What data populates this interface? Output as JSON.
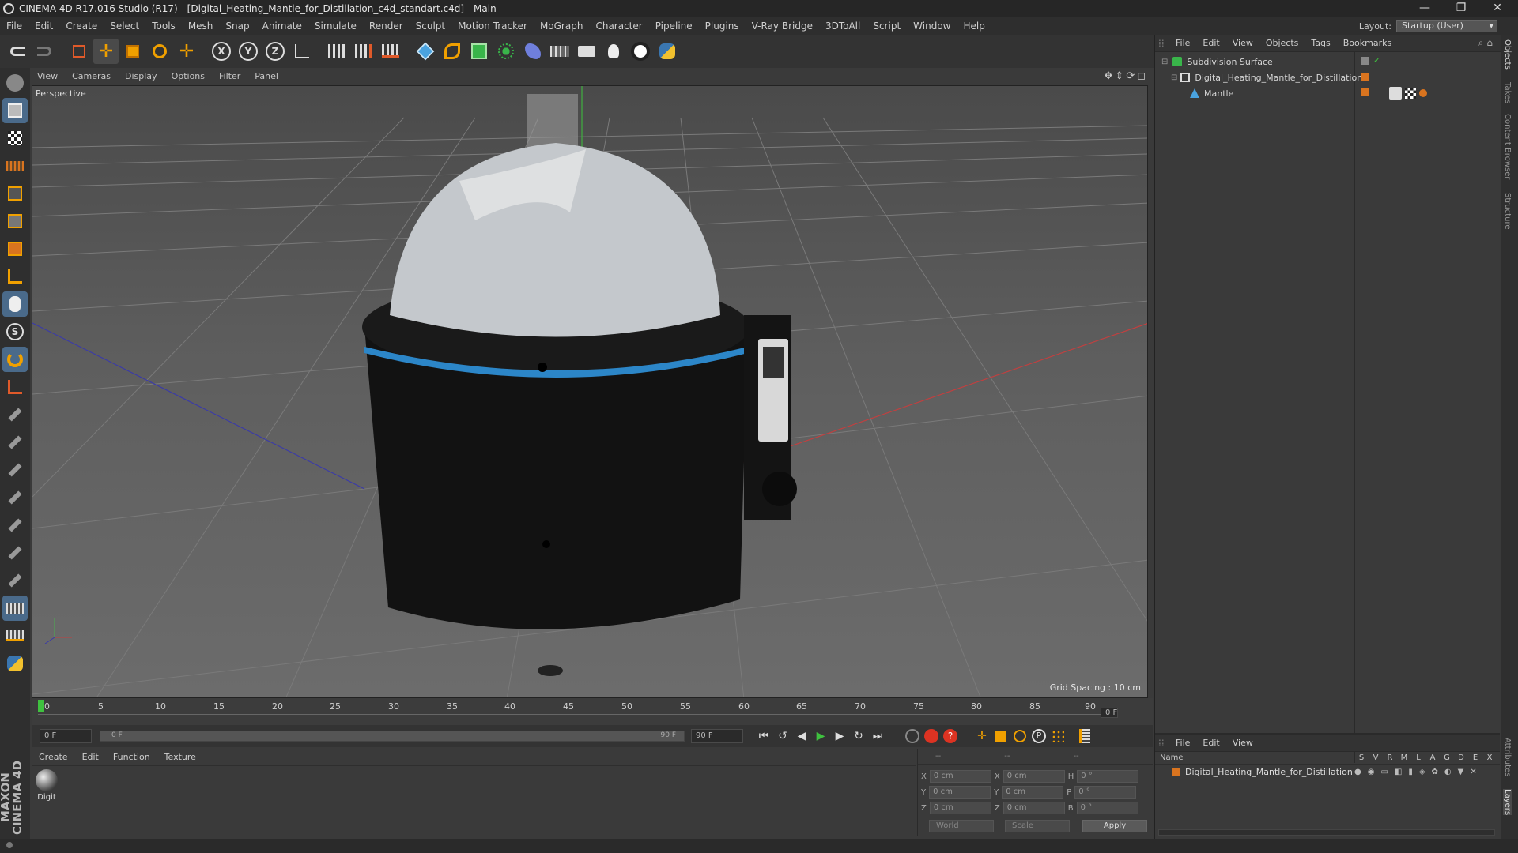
{
  "window": {
    "title": "CINEMA 4D R17.016 Studio (R17) - [Digital_Heating_Mantle_for_Distillation_c4d_standart.c4d] - Main",
    "minimize": "—",
    "restore": "❐",
    "close": "✕"
  },
  "menu": [
    "File",
    "Edit",
    "Create",
    "Select",
    "Tools",
    "Mesh",
    "Snap",
    "Animate",
    "Simulate",
    "Render",
    "Sculpt",
    "Motion Tracker",
    "MoGraph",
    "Character",
    "Pipeline",
    "Plugins",
    "V-Ray Bridge",
    "3DToAll",
    "Script",
    "Window",
    "Help"
  ],
  "layout": {
    "label": "Layout:",
    "value": "Startup (User)"
  },
  "viewport": {
    "menu": [
      "View",
      "Cameras",
      "Display",
      "Options",
      "Filter",
      "Panel"
    ],
    "label": "Perspective",
    "grid_spacing": "Grid Spacing : 10 cm"
  },
  "timeline": {
    "ticks": [
      "0",
      "5",
      "10",
      "15",
      "20",
      "25",
      "30",
      "35",
      "40",
      "45",
      "50",
      "55",
      "60",
      "65",
      "70",
      "75",
      "80",
      "85",
      "90"
    ],
    "current_frame": "0 F"
  },
  "transport": {
    "start": "0 F",
    "range_start": "0 F",
    "range_end": "90 F",
    "end": "90 F"
  },
  "material_panel": {
    "menu": [
      "Create",
      "Edit",
      "Function",
      "Texture"
    ],
    "material_name": "Digit"
  },
  "coords": {
    "headers": [
      "--",
      "--",
      "--"
    ],
    "rows": [
      {
        "a": "X",
        "v1": "0 cm",
        "b": "X",
        "v2": "0 cm",
        "c": "H",
        "v3": "0 °"
      },
      {
        "a": "Y",
        "v1": "0 cm",
        "b": "Y",
        "v2": "0 cm",
        "c": "P",
        "v3": "0 °"
      },
      {
        "a": "Z",
        "v1": "0 cm",
        "b": "Z",
        "v2": "0 cm",
        "c": "B",
        "v3": "0 °"
      }
    ],
    "world": "World",
    "scale": "Scale",
    "apply": "Apply"
  },
  "objects_panel": {
    "menu": [
      "File",
      "Edit",
      "View",
      "Objects",
      "Tags",
      "Bookmarks"
    ],
    "items": [
      {
        "name": "Subdivision Surface",
        "indent": 0
      },
      {
        "name": "Digital_Heating_Mantle_for_Distillation",
        "indent": 1
      },
      {
        "name": "Mantle",
        "indent": 2
      }
    ]
  },
  "layers_panel": {
    "menu": [
      "File",
      "Edit",
      "View"
    ],
    "columns": [
      "Name",
      "S",
      "V",
      "R",
      "M",
      "L",
      "A",
      "G",
      "D",
      "E",
      "X"
    ],
    "row": "Digital_Heating_Mantle_for_Distillation"
  },
  "side_tabs": [
    "Objects",
    "Takes",
    "Content Browser",
    "Structure",
    "Attributes",
    "Layers"
  ],
  "brand": "MAXON CINEMA 4D",
  "colors": {
    "accent_blue": "#2c86c8",
    "orange_tag": "#d9741f"
  }
}
